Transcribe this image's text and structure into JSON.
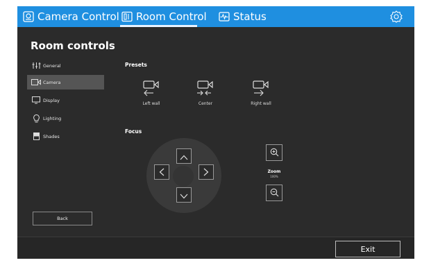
{
  "tabs": [
    {
      "label": "Camera Control",
      "icon": "camera-frame-icon",
      "active": false
    },
    {
      "label": "Room Control",
      "icon": "room-panel-icon",
      "active": true
    },
    {
      "label": "Status",
      "icon": "pulse-icon",
      "active": false
    }
  ],
  "settings_icon": "gear-icon",
  "accent_color": "#1f8fe0",
  "page_title": "Room controls",
  "sidebar": {
    "items": [
      {
        "label": "General",
        "icon": "sliders-icon",
        "active": false
      },
      {
        "label": "Camera",
        "icon": "video-camera-icon",
        "active": true
      },
      {
        "label": "Display",
        "icon": "monitor-icon",
        "active": false
      },
      {
        "label": "Lighting",
        "icon": "lightbulb-icon",
        "active": false
      },
      {
        "label": "Shades",
        "icon": "shades-icon",
        "active": false
      }
    ],
    "back_label": "Back"
  },
  "presets": {
    "title": "Presets",
    "items": [
      {
        "label": "Left wall",
        "icon": "camera-arrow-left-icon"
      },
      {
        "label": "Center",
        "icon": "camera-arrows-center-icon"
      },
      {
        "label": "Right wall",
        "icon": "camera-arrow-right-icon"
      }
    ]
  },
  "focus": {
    "title": "Focus",
    "zoom_label": "Zoom",
    "zoom_value": "100%"
  },
  "footer": {
    "exit_label": "Exit"
  }
}
